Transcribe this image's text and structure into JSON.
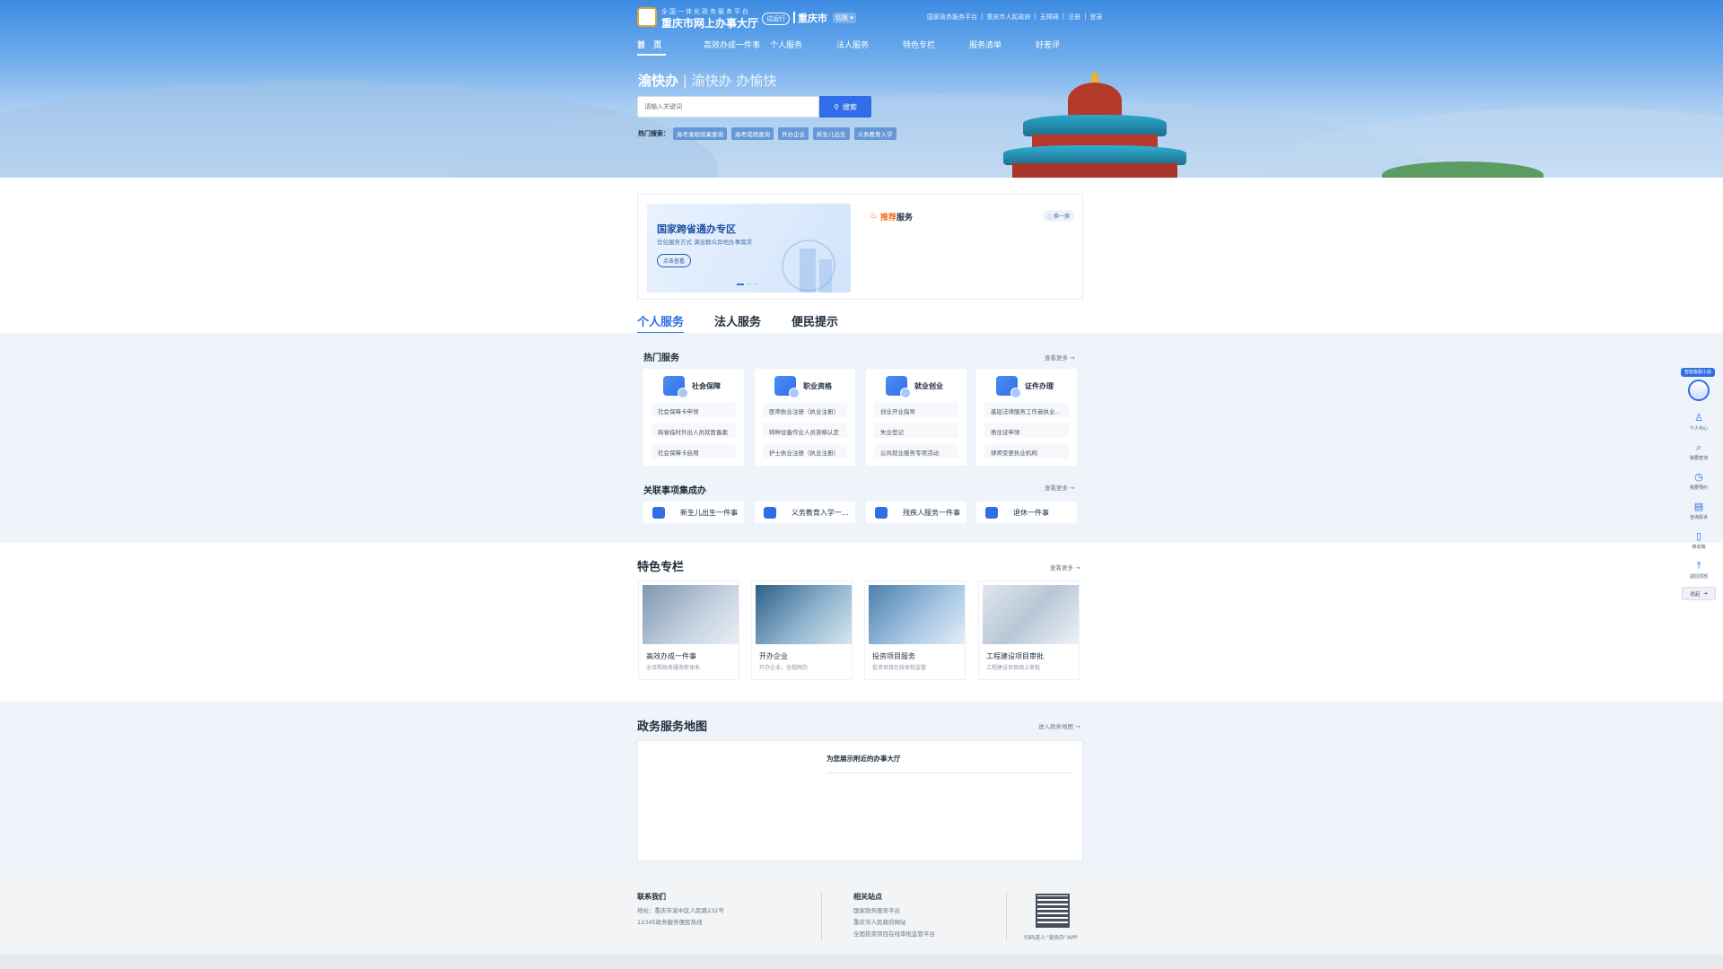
{
  "header": {
    "logo_subtitle": "全国一体化政务服务平台",
    "logo_title": "重庆市网上办事大厅",
    "run_tag": "试运行",
    "city": "重庆市",
    "switch_label": "切换",
    "top_links": [
      "国家政务服务平台",
      "重庆市人民政府",
      "无障碍",
      "注册",
      "登录"
    ],
    "nav": [
      "首 页",
      "高效办成一件事",
      "个人服务",
      "法人服务",
      "特色专栏",
      "服务清单",
      "好差评"
    ]
  },
  "hero": {
    "slogan_main": "渝快办",
    "slogan_sub": "渝快办 办愉快",
    "search": {
      "placeholder": "请输入关键词",
      "button_label": "搜索"
    },
    "hot_label": "热门搜索：",
    "hot_tags": [
      "高考录取结果查询",
      "高考成绩查询",
      "开办企业",
      "新生儿出生",
      "义务教育入学"
    ]
  },
  "banner": {
    "title": "国家跨省通办专区",
    "subtitle": "优化服务方式  满足群众异地办事需求",
    "button_label": "点击查看",
    "recommend_prefix": "推荐",
    "recommend_suffix": "服务",
    "refresh_label": "换一换"
  },
  "tabs": [
    "个人服务",
    "法人服务",
    "便民提示"
  ],
  "hot_services": {
    "title": "热门服务",
    "more": "查看更多",
    "cards": [
      {
        "name": "社会保障",
        "items": [
          "社会保障卡申领",
          "跨省临时外出人员就医备案",
          "社会保障卡启用"
        ]
      },
      {
        "name": "职业资格",
        "items": [
          "医师执业注册（执业注册）",
          "特种设备作业人员资格认定",
          "护士执业注册（执业注册）"
        ]
      },
      {
        "name": "就业创业",
        "items": [
          "创业开业指导",
          "失业登记",
          "公共就业服务专项活动"
        ]
      },
      {
        "name": "证件办理",
        "items": [
          "基层法律服务工作者执业核准",
          "居住证申领",
          "律师变更执业机构"
        ]
      }
    ]
  },
  "combo_services": {
    "title": "关联事项集成办",
    "more": "查看更多",
    "items": [
      "新生儿出生一件事",
      "义务教育入学一件事",
      "残疾人服务一件事",
      "退休一件事"
    ]
  },
  "featured": {
    "title": "特色专栏",
    "more": "查看更多",
    "cards": [
      {
        "name": "高效办成一件事",
        "desc": "全流程政务服务新体系"
      },
      {
        "name": "开办企业",
        "desc": "开办企业，全程网办"
      },
      {
        "name": "投资项目服务",
        "desc": "投资项目在线审批监管"
      },
      {
        "name": "工程建设项目审批",
        "desc": "工程建设项目网上审批"
      }
    ]
  },
  "service_map": {
    "title": "政务服务地图",
    "more": "进入政务地图",
    "panel_title": "为您展示附近的办事大厅"
  },
  "footer": {
    "contact_title": "联系我们",
    "contact_lines": [
      "地址：重庆市渝中区人民路232号",
      "12345政务服务便民热线"
    ],
    "related_title": "相关站点",
    "related_lines": [
      "国家政务服务平台",
      "重庆市人民政府网站",
      "全国投资项目在线审批监管平台"
    ],
    "qr_caption": "扫码进入“渝快办”APP"
  },
  "sidebar": {
    "badge": "智能客服小渝",
    "items": [
      "个人中心",
      "我要查询",
      "我要预约",
      "咨询投诉",
      "移动端",
      "返回顶部"
    ],
    "collapse_label": "收起"
  },
  "colors": {
    "primary": "#2f6ee6",
    "accent_orange": "#f26b1d",
    "hero_top": "#3c8be2"
  }
}
